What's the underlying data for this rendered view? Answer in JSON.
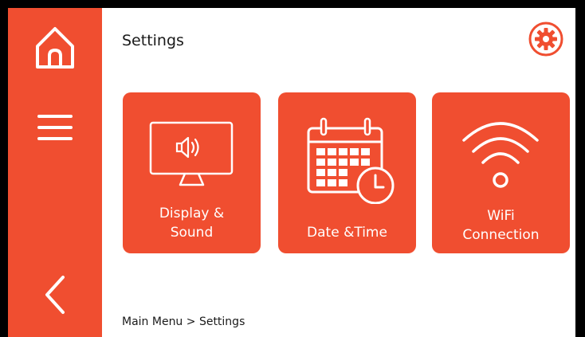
{
  "header": {
    "title": "Settings",
    "settings_icon": "gear-icon"
  },
  "sidebar": {
    "items": [
      {
        "name": "home",
        "icon": "home-icon"
      },
      {
        "name": "menu",
        "icon": "hamburger-menu-icon"
      },
      {
        "name": "back",
        "icon": "chevron-left-icon"
      }
    ]
  },
  "tiles": [
    {
      "label": "Display &\nSound",
      "icon": "monitor-speaker-icon"
    },
    {
      "label": "Date &Time",
      "icon": "calendar-clock-icon"
    },
    {
      "label": "WiFi\nConnection",
      "icon": "wifi-icon"
    }
  ],
  "breadcrumb": "Main Menu > Settings",
  "colors": {
    "accent": "#f04e30",
    "background": "#ffffff",
    "frame": "#000000",
    "text": "#1a1a1a"
  }
}
